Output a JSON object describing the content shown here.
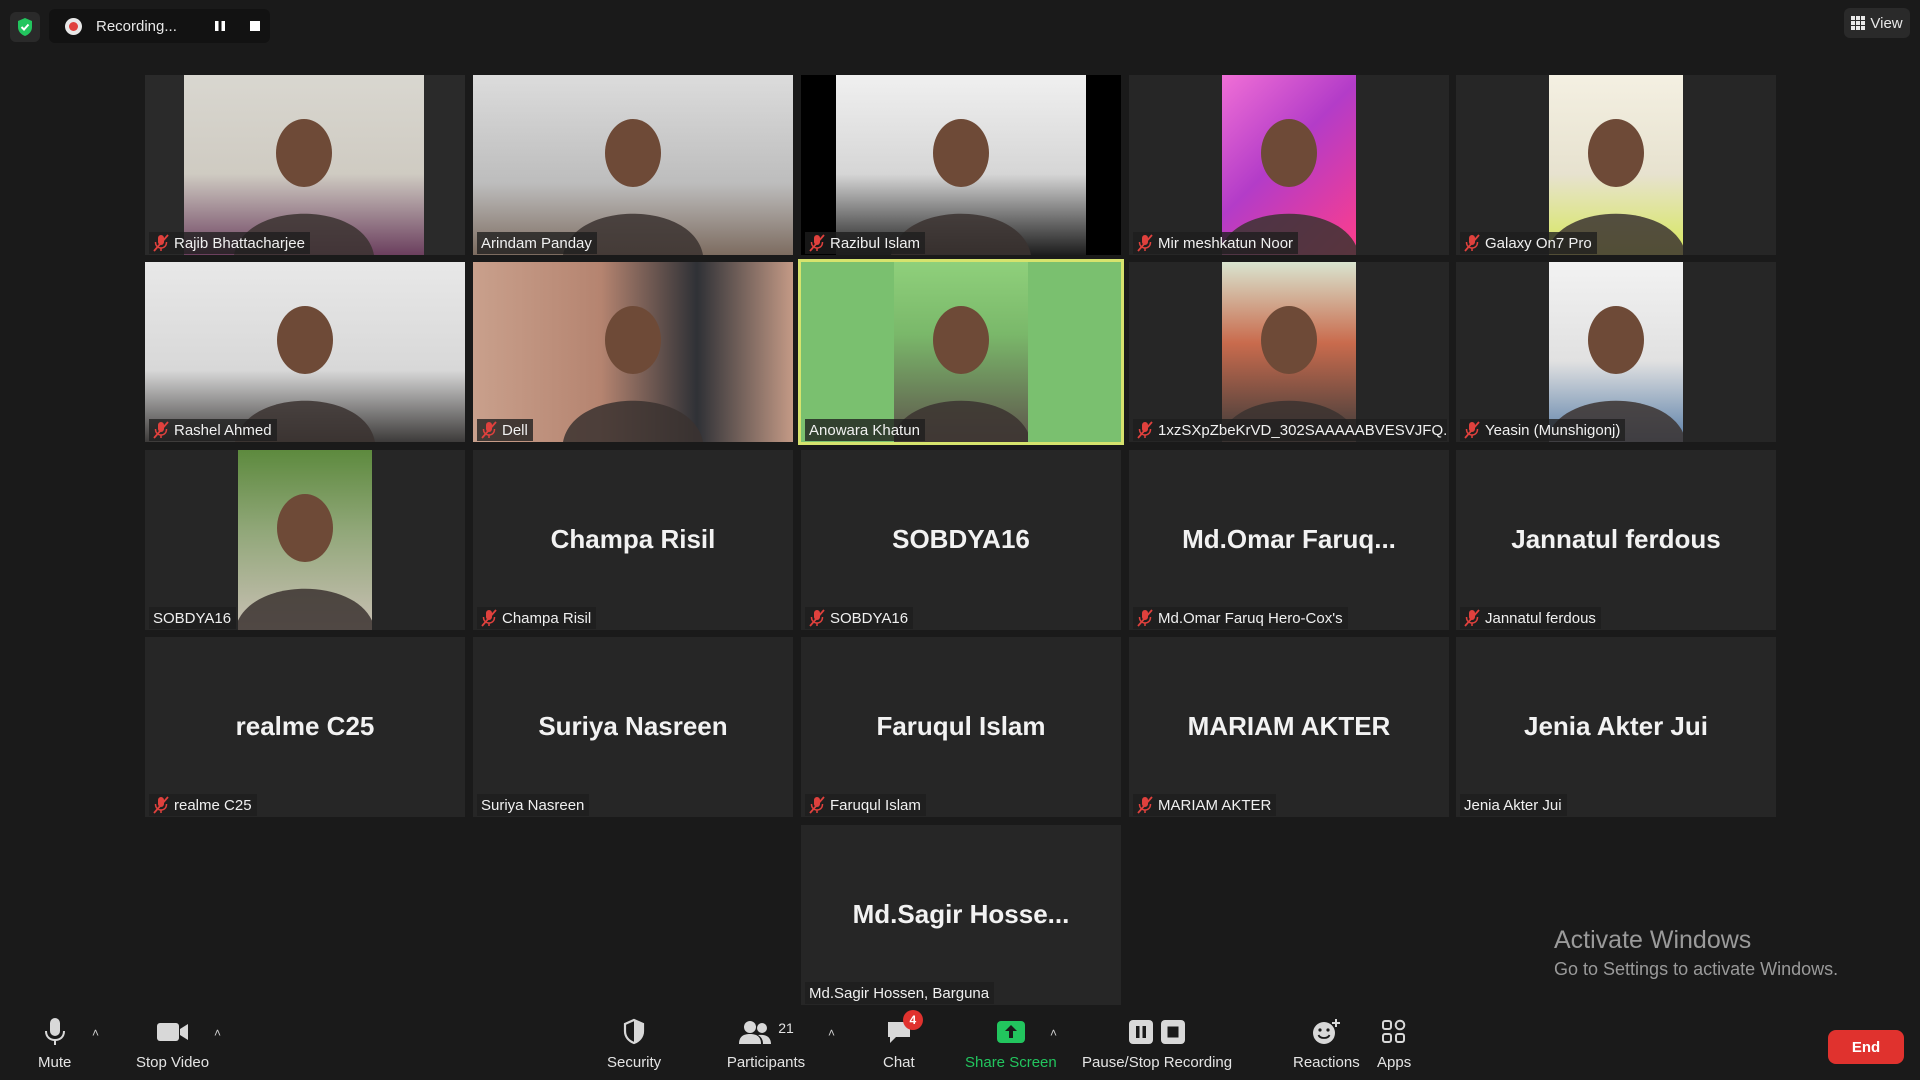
{
  "topbar": {
    "recording_label": "Recording...",
    "view_label": "View"
  },
  "participants": [
    {
      "tile_name": "",
      "label": "Rajib Bhattacharjee",
      "muted": true,
      "video": true,
      "scene": "room"
    },
    {
      "tile_name": "",
      "label": "Arindam Panday",
      "muted": false,
      "video": true,
      "scene": "grey"
    },
    {
      "tile_name": "",
      "label": "Razibul Islam",
      "muted": true,
      "video": true,
      "scene": "dark"
    },
    {
      "tile_name": "",
      "label": "Mir meshkatun Noor",
      "muted": true,
      "video": true,
      "scene": "pink"
    },
    {
      "tile_name": "",
      "label": "Galaxy On7 Pro",
      "muted": true,
      "video": true,
      "scene": "yellow"
    },
    {
      "tile_name": "",
      "label": "Rashel Ahmed",
      "muted": true,
      "video": true,
      "scene": "wall"
    },
    {
      "tile_name": "",
      "label": "Dell",
      "muted": true,
      "video": true,
      "scene": "curtain"
    },
    {
      "tile_name": "",
      "label": "Anowara Khatun",
      "muted": false,
      "video": true,
      "scene": "green",
      "active": true
    },
    {
      "tile_name": "",
      "label": "1xzSXpZbeKrVD_302SAAAAABVESVJFQ...",
      "muted": true,
      "video": true,
      "scene": "shelf"
    },
    {
      "tile_name": "",
      "label": "Yeasin (Munshigonj)",
      "muted": true,
      "video": true,
      "scene": "blue"
    },
    {
      "tile_name": "",
      "label": "SOBDYA16",
      "muted": false,
      "video": true,
      "scene": "tree"
    },
    {
      "tile_name": "Champa Risil",
      "label": "Champa Risil",
      "muted": true,
      "video": false
    },
    {
      "tile_name": "SOBDYA16",
      "label": "SOBDYA16",
      "muted": true,
      "video": false
    },
    {
      "tile_name": "Md.Omar  Faruq...",
      "label": "Md.Omar Faruq Hero-Cox's",
      "muted": true,
      "video": false
    },
    {
      "tile_name": "Jannatul ferdous",
      "label": "Jannatul ferdous",
      "muted": true,
      "video": false
    },
    {
      "tile_name": "realme C25",
      "label": "realme C25",
      "muted": true,
      "video": false
    },
    {
      "tile_name": "Suriya Nasreen",
      "label": "Suriya Nasreen",
      "muted": false,
      "video": false
    },
    {
      "tile_name": "Faruqul Islam",
      "label": "Faruqul Islam",
      "muted": true,
      "video": false
    },
    {
      "tile_name": "MARIAM AKTER",
      "label": "MARIAM AKTER",
      "muted": true,
      "video": false
    },
    {
      "tile_name": "Jenia Akter Jui",
      "label": "Jenia Akter Jui",
      "muted": false,
      "video": false
    },
    {
      "tile_name": "Md.Sagir  Hosse...",
      "label": "Md.Sagir Hossen, Barguna",
      "muted": false,
      "video": false
    }
  ],
  "watermark": {
    "title": "Activate Windows",
    "subtitle": "Go to Settings to activate Windows."
  },
  "toolbar": {
    "mute": "Mute",
    "stop_video": "Stop Video",
    "security": "Security",
    "participants": "Participants",
    "participants_count": "21",
    "chat": "Chat",
    "chat_badge": "4",
    "share_screen": "Share Screen",
    "pause_stop": "Pause/Stop Recording",
    "reactions": "Reactions",
    "apps": "Apps",
    "end": "End"
  },
  "colors": {
    "accent_green": "#22c55e",
    "active_speaker": "#d6e36d",
    "end_red": "#e0322e",
    "muted_red": "#e0413d"
  }
}
